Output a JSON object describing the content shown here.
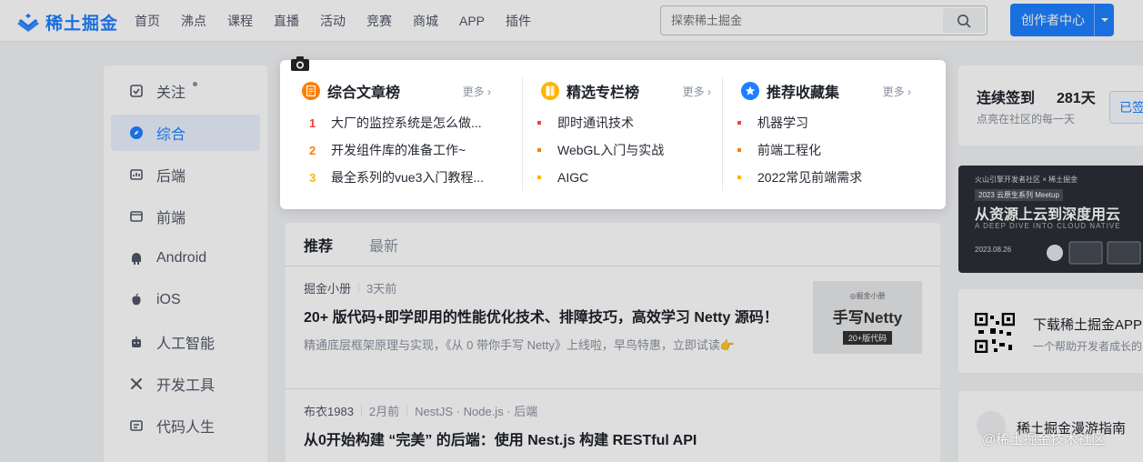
{
  "header": {
    "logo_text": "稀土掘金",
    "nav": [
      "首页",
      "沸点",
      "课程",
      "直播",
      "活动",
      "竞赛",
      "商城",
      "APP",
      "插件"
    ],
    "search_placeholder": "探索稀土掘金",
    "creator_label": "创作者中心"
  },
  "sidebar": {
    "items": [
      {
        "label": "关注",
        "icon": "follow-icon"
      },
      {
        "label": "综合",
        "icon": "compass-icon"
      },
      {
        "label": "后端",
        "icon": "backend-icon"
      },
      {
        "label": "前端",
        "icon": "frontend-icon"
      },
      {
        "label": "Android",
        "icon": "android-icon"
      },
      {
        "label": "iOS",
        "icon": "apple-icon"
      },
      {
        "label": "人工智能",
        "icon": "robot-icon"
      },
      {
        "label": "开发工具",
        "icon": "tools-icon"
      },
      {
        "label": "代码人生",
        "icon": "code-life-icon"
      }
    ]
  },
  "rankings": {
    "columns": [
      {
        "title": "综合文章榜",
        "more": "更多",
        "items": [
          "大厂的监控系统是怎么做...",
          "开发组件库的准备工作~",
          "最全系列的vue3入门教程..."
        ],
        "numbers": [
          "1",
          "2",
          "3"
        ]
      },
      {
        "title": "精选专栏榜",
        "more": "更多",
        "items": [
          "即时通讯技术",
          "WebGL入门与实战",
          "AIGC"
        ]
      },
      {
        "title": "推荐收藏集",
        "more": "更多",
        "items": [
          "机器学习",
          "前端工程化",
          "2022常见前端需求"
        ]
      }
    ]
  },
  "feed": {
    "tabs": [
      "推荐",
      "最新"
    ],
    "entries": [
      {
        "author": "掘金小册",
        "time": "3天前",
        "title": "20+ 版代码+即学即用的性能优化技术、排障技巧，高效学习 Netty 源码！",
        "desc": "精通底层框架原理与实现，《从 0 带你手写 Netty》上线啦，早鸟特惠，立即试读👉",
        "thumb_top": "◎掘金小册",
        "thumb_main": "手写Netty",
        "thumb_sub": "20+版代码"
      },
      {
        "author": "布衣1983",
        "time": "2月前",
        "tags": "NestJS · Node.js · 后端",
        "title": "从0开始构建 “完美” 的后端：使用 Nest.js 构建 RESTful API"
      }
    ]
  },
  "right": {
    "checkin_title": "连续签到",
    "checkin_days": "281天",
    "checkin_sub": "点亮在社区的每一天",
    "checkin_btn": "已签",
    "banner_tag": "火山引擎开发者社区 × 稀土掘金",
    "banner_series": "2023 云原生系列 Meetup",
    "banner_title": "从资源上云到深度用云",
    "banner_en": "A DEEP DIVE INTO CLOUD NATIVE",
    "banner_date": "2023.08.26",
    "app_title": "下载稀土掘金APP",
    "app_sub": "一个帮助开发者成长的",
    "guide_title": "稀土掘金漫游指南"
  },
  "watermark": "@稀土掘金技术社区",
  "colors": {
    "brand": "#1e80ff",
    "rank1": "#f53f3f",
    "rank2": "#ff7d00",
    "rank3": "#ffb400"
  }
}
